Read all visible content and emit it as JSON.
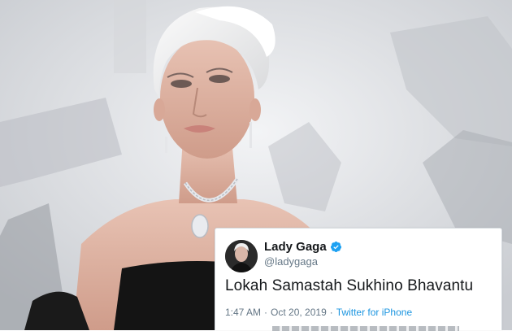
{
  "tweet": {
    "display_name": "Lady Gaga",
    "handle": "@ladygaga",
    "text": "Lokah Samastah Sukhino Bhavantu",
    "time": "1:47 AM",
    "date": "Oct 20, 2019",
    "separator": "·",
    "source": "Twitter for iPhone",
    "verified_icon": "verified-badge-icon"
  },
  "photo": {
    "subject_icon": "portrait-photo"
  },
  "colors": {
    "verified_blue": "#1da1f2",
    "link_blue": "#1b95e0",
    "text_dark": "#14171a",
    "text_gray": "#657786"
  }
}
